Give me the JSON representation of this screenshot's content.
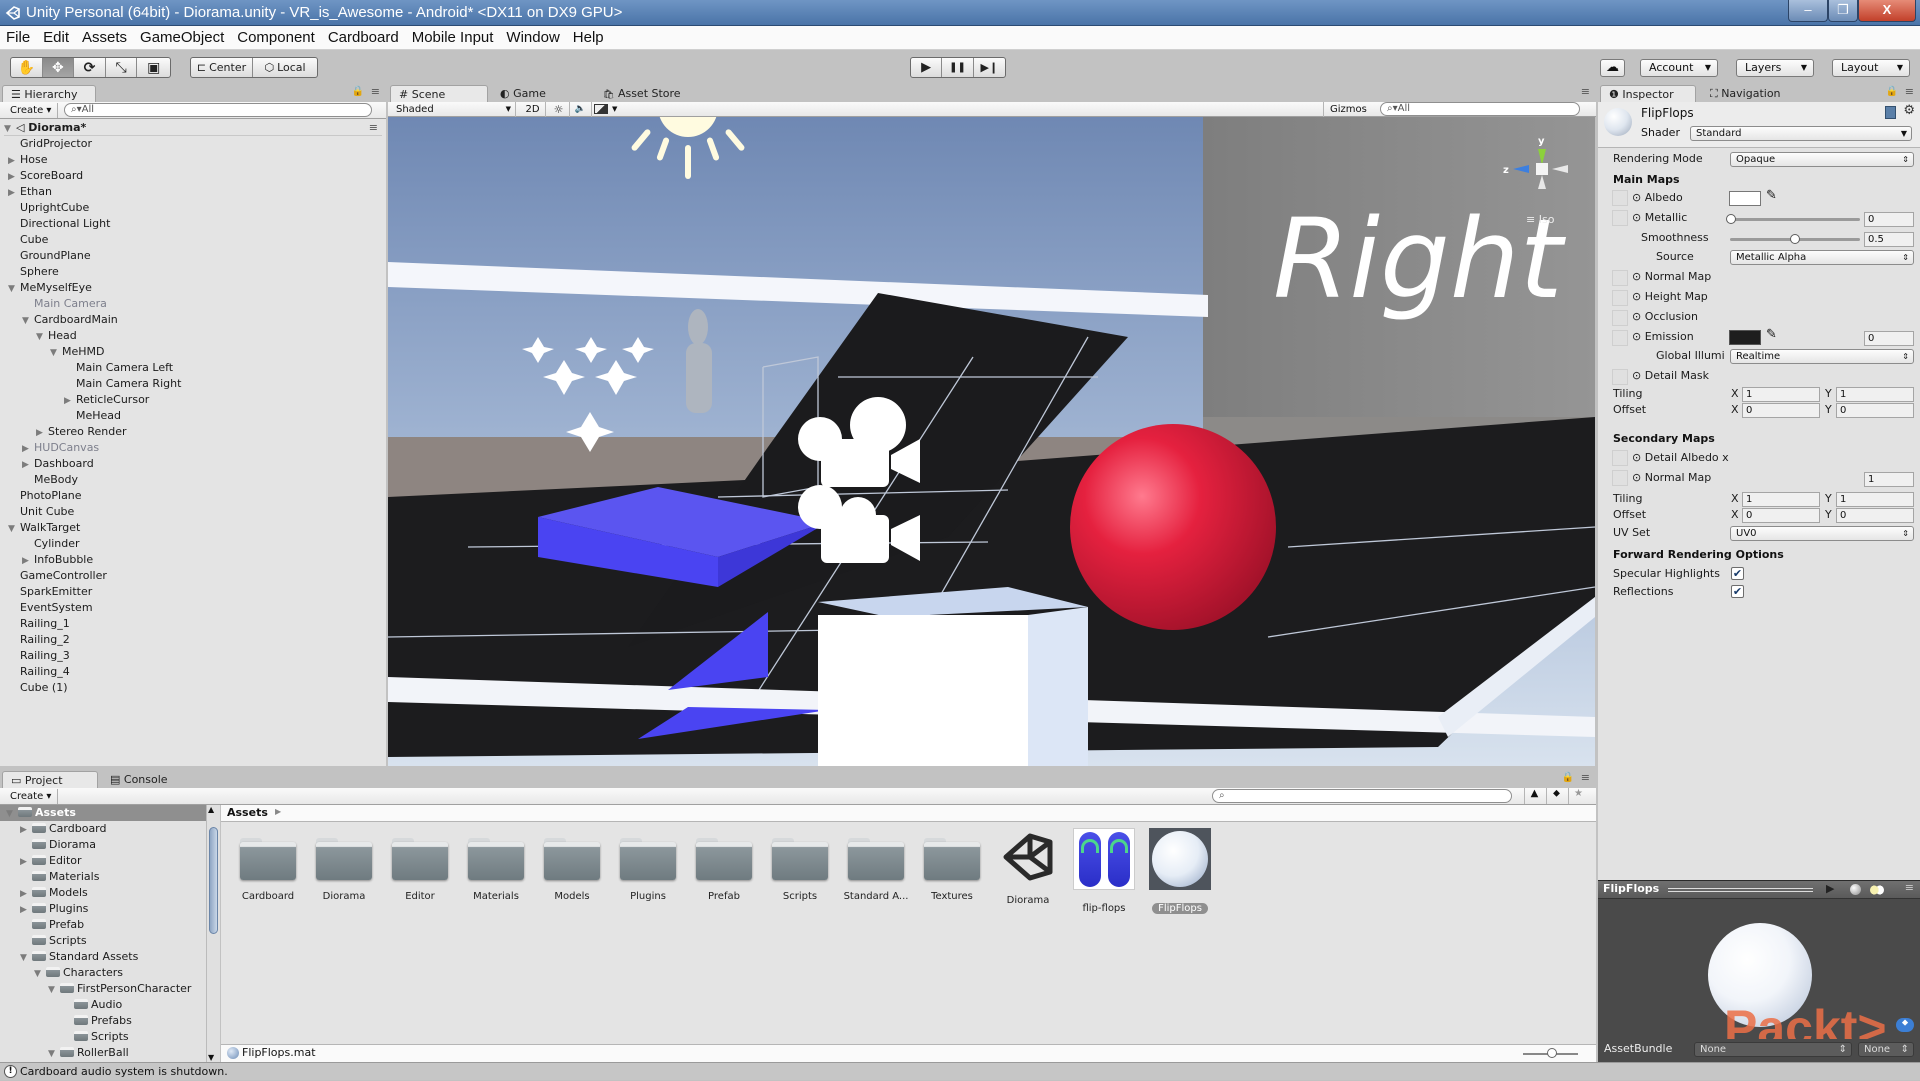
{
  "window": {
    "title": "Unity Personal (64bit) - Diorama.unity - VR_is_Awesome - Android* <DX11 on DX9 GPU>",
    "minimize": "–",
    "restore": "❐",
    "close": "X"
  },
  "menu": [
    "File",
    "Edit",
    "Assets",
    "GameObject",
    "Component",
    "Cardboard",
    "Mobile Input",
    "Window",
    "Help"
  ],
  "toolbar": {
    "tools": [
      {
        "name": "hand-tool",
        "glyph": "✋"
      },
      {
        "name": "move-tool",
        "glyph": "✥",
        "active": true
      },
      {
        "name": "rotate-tool",
        "glyph": "⟳"
      },
      {
        "name": "scale-tool",
        "glyph": "⤡"
      },
      {
        "name": "rect-tool",
        "glyph": "▣"
      }
    ],
    "pivot": "Center",
    "pivot_icon": "⊏",
    "space": "Local",
    "space_icon": "⬡",
    "play": "▶",
    "pause": "❚❚",
    "step": "▶❙",
    "cloud_icon": "☁",
    "account": "Account",
    "layers": "Layers",
    "layout": "Layout"
  },
  "hierarchy": {
    "tab": "Hierarchy",
    "create": "Create",
    "search_placeholder": "All",
    "scene_name": "Diorama*",
    "rows": [
      {
        "label": "GridProjector",
        "depth": 1,
        "arrow": ""
      },
      {
        "label": "Hose",
        "depth": 1,
        "arrow": "▶"
      },
      {
        "label": "ScoreBoard",
        "depth": 1,
        "arrow": "▶"
      },
      {
        "label": "Ethan",
        "depth": 1,
        "arrow": "▶"
      },
      {
        "label": "UprightCube",
        "depth": 1,
        "arrow": ""
      },
      {
        "label": "Directional Light",
        "depth": 1,
        "arrow": ""
      },
      {
        "label": "Cube",
        "depth": 1,
        "arrow": ""
      },
      {
        "label": "GroundPlane",
        "depth": 1,
        "arrow": ""
      },
      {
        "label": "Sphere",
        "depth": 1,
        "arrow": ""
      },
      {
        "label": "MeMyselfEye",
        "depth": 1,
        "arrow": "▼"
      },
      {
        "label": "Main Camera",
        "depth": 2,
        "arrow": "",
        "dim": true
      },
      {
        "label": "CardboardMain",
        "depth": 2,
        "arrow": "▼"
      },
      {
        "label": "Head",
        "depth": 3,
        "arrow": "▼"
      },
      {
        "label": "MeHMD",
        "depth": 4,
        "arrow": "▼"
      },
      {
        "label": "Main Camera Left",
        "depth": 5,
        "arrow": ""
      },
      {
        "label": "Main Camera Right",
        "depth": 5,
        "arrow": ""
      },
      {
        "label": "ReticleCursor",
        "depth": 5,
        "arrow": "▶"
      },
      {
        "label": "MeHead",
        "depth": 5,
        "arrow": ""
      },
      {
        "label": "Stereo Render",
        "depth": 3,
        "arrow": "▶"
      },
      {
        "label": "HUDCanvas",
        "depth": 2,
        "arrow": "▶",
        "dim": true
      },
      {
        "label": "Dashboard",
        "depth": 2,
        "arrow": "▶"
      },
      {
        "label": "MeBody",
        "depth": 2,
        "arrow": ""
      },
      {
        "label": "PhotoPlane",
        "depth": 1,
        "arrow": ""
      },
      {
        "label": "Unit Cube",
        "depth": 1,
        "arrow": ""
      },
      {
        "label": "WalkTarget",
        "depth": 1,
        "arrow": "▼"
      },
      {
        "label": "Cylinder",
        "depth": 2,
        "arrow": ""
      },
      {
        "label": "InfoBubble",
        "depth": 2,
        "arrow": "▶"
      },
      {
        "label": "GameController",
        "depth": 1,
        "arrow": ""
      },
      {
        "label": "SparkEmitter",
        "depth": 1,
        "arrow": ""
      },
      {
        "label": "EventSystem",
        "depth": 1,
        "arrow": ""
      },
      {
        "label": "Railing_1",
        "depth": 1,
        "arrow": ""
      },
      {
        "label": "Railing_2",
        "depth": 1,
        "arrow": ""
      },
      {
        "label": "Railing_3",
        "depth": 1,
        "arrow": ""
      },
      {
        "label": "Railing_4",
        "depth": 1,
        "arrow": ""
      },
      {
        "label": "Cube (1)",
        "depth": 1,
        "arrow": ""
      }
    ]
  },
  "scene": {
    "tabs": [
      {
        "label": "Scene",
        "icon": "#"
      },
      {
        "label": "Game",
        "icon": "◐"
      },
      {
        "label": "Asset Store",
        "icon": "🛍"
      }
    ],
    "draw_mode": "Shaded",
    "mode_2d": "2D",
    "lighting_icon": "☼",
    "audio_icon": "🔈",
    "effects_icon": "▬",
    "gizmos": "Gizmos",
    "search_placeholder": "All",
    "gizmo_axis_y": "y",
    "gizmo_axis_z": "z",
    "projection": "Iso",
    "wall_text": "Right",
    "colors": {
      "sky": "#7b93b8",
      "ground": "#1c1c1e",
      "blue_box": "#4a44f2",
      "red_sphere": "#e0213f",
      "wall": "#8a8a8a"
    }
  },
  "inspector": {
    "tab": "Inspector",
    "nav_tab": "Navigation",
    "material_name": "FlipFlops",
    "shader_label": "Shader",
    "shader": "Standard",
    "rendering_mode_label": "Rendering Mode",
    "rendering_mode": "Opaque",
    "main_maps": "Main Maps",
    "albedo": "Albedo",
    "albedo_color": "#ffffff",
    "metallic": "Metallic",
    "metallic_value": "0",
    "smoothness": "Smoothness",
    "smoothness_value": "0.5",
    "source_label": "Source",
    "source": "Metallic Alpha",
    "normal_map": "Normal Map",
    "height_map": "Height Map",
    "occlusion": "Occlusion",
    "emission": "Emission",
    "emission_color": "#1e1e1e",
    "emission_value": "0",
    "gi_label": "Global Illumi",
    "gi": "Realtime",
    "detail_mask": "Detail Mask",
    "tiling": "Tiling",
    "offset": "Offset",
    "main_tiling": {
      "x": "1",
      "y": "1"
    },
    "main_offset": {
      "x": "0",
      "y": "0"
    },
    "secondary_maps": "Secondary Maps",
    "detail_albedo": "Detail Albedo x",
    "sec_normal_map": "Normal Map",
    "sec_normal_value": "1",
    "sec_tiling": {
      "x": "1",
      "y": "1"
    },
    "sec_offset": {
      "x": "0",
      "y": "0"
    },
    "uv_set_label": "UV Set",
    "uv_set": "UV0",
    "forward_options": "Forward Rendering Options",
    "specular": "Specular Highlights",
    "specular_checked": true,
    "reflections": "Reflections",
    "reflections_checked": true,
    "x": "X",
    "y": "Y",
    "check": "✔"
  },
  "preview": {
    "title": "FlipFlops",
    "play": "▶",
    "assetbundle_label": "AssetBundle",
    "bundle": "None",
    "variant": "None",
    "watermark": "Packt>"
  },
  "project": {
    "tab": "Project",
    "console_tab": "Console",
    "create": "Create",
    "tree": [
      {
        "label": "Assets",
        "depth": 0,
        "arrow": "▼",
        "selected": true
      },
      {
        "label": "Cardboard",
        "depth": 1,
        "arrow": "▶"
      },
      {
        "label": "Diorama",
        "depth": 1,
        "arrow": ""
      },
      {
        "label": "Editor",
        "depth": 1,
        "arrow": "▶"
      },
      {
        "label": "Materials",
        "depth": 1,
        "arrow": ""
      },
      {
        "label": "Models",
        "depth": 1,
        "arrow": "▶"
      },
      {
        "label": "Plugins",
        "depth": 1,
        "arrow": "▶"
      },
      {
        "label": "Prefab",
        "depth": 1,
        "arrow": ""
      },
      {
        "label": "Scripts",
        "depth": 1,
        "arrow": ""
      },
      {
        "label": "Standard Assets",
        "depth": 1,
        "arrow": "▼"
      },
      {
        "label": "Characters",
        "depth": 2,
        "arrow": "▼"
      },
      {
        "label": "FirstPersonCharacter",
        "depth": 3,
        "arrow": "▼"
      },
      {
        "label": "Audio",
        "depth": 4,
        "arrow": ""
      },
      {
        "label": "Prefabs",
        "depth": 4,
        "arrow": ""
      },
      {
        "label": "Scripts",
        "depth": 4,
        "arrow": ""
      },
      {
        "label": "RollerBall",
        "depth": 3,
        "arrow": "▼"
      }
    ],
    "breadcrumb": "Assets",
    "assets": [
      {
        "label": "Cardboard",
        "type": "folder"
      },
      {
        "label": "Diorama",
        "type": "folder"
      },
      {
        "label": "Editor",
        "type": "folder"
      },
      {
        "label": "Materials",
        "type": "folder"
      },
      {
        "label": "Models",
        "type": "folder"
      },
      {
        "label": "Plugins",
        "type": "folder"
      },
      {
        "label": "Prefab",
        "type": "folder"
      },
      {
        "label": "Scripts",
        "type": "folder"
      },
      {
        "label": "Standard A...",
        "type": "folder"
      },
      {
        "label": "Textures",
        "type": "folder"
      },
      {
        "label": "Diorama",
        "type": "scene"
      },
      {
        "label": "flip-flops",
        "type": "texture"
      },
      {
        "label": "FlipFlops",
        "type": "material",
        "selected": true
      }
    ],
    "selected_file": "FlipFlops.mat"
  },
  "status": {
    "message": "Cardboard audio system is shutdown.",
    "icon": "!"
  }
}
